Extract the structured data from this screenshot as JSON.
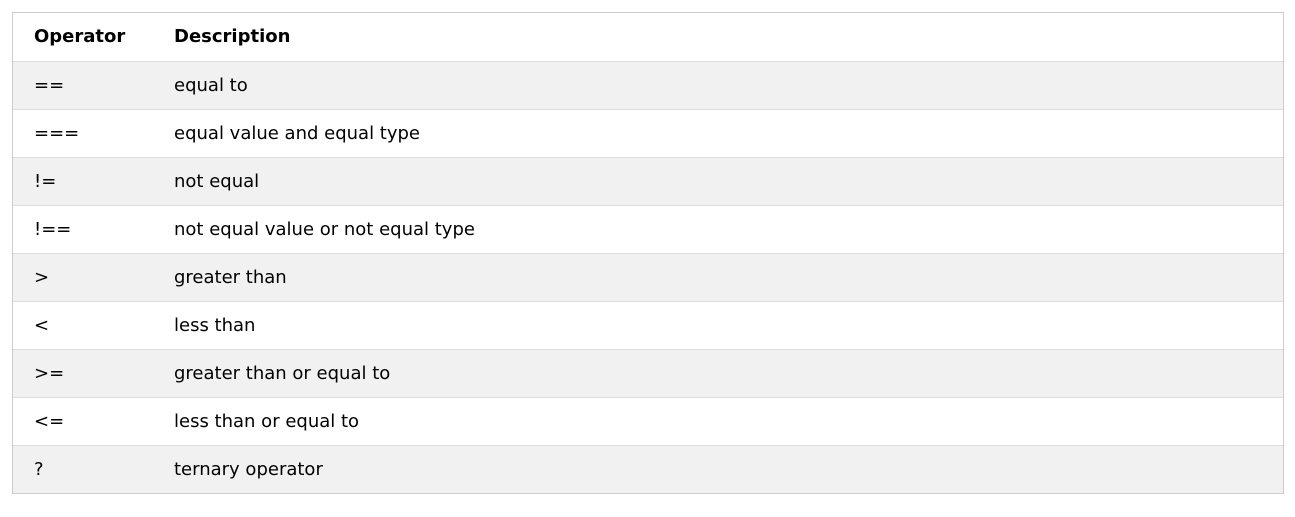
{
  "table": {
    "headers": [
      "Operator",
      "Description"
    ],
    "rows": [
      {
        "operator": "==",
        "description": "equal to"
      },
      {
        "operator": "===",
        "description": "equal value and equal type"
      },
      {
        "operator": "!=",
        "description": "not equal"
      },
      {
        "operator": "!==",
        "description": "not equal value or not equal type"
      },
      {
        "operator": ">",
        "description": "greater than"
      },
      {
        "operator": "<",
        "description": "less than"
      },
      {
        "operator": ">=",
        "description": "greater than or equal to"
      },
      {
        "operator": "<=",
        "description": "less than or equal to"
      },
      {
        "operator": "?",
        "description": "ternary operator"
      }
    ]
  }
}
